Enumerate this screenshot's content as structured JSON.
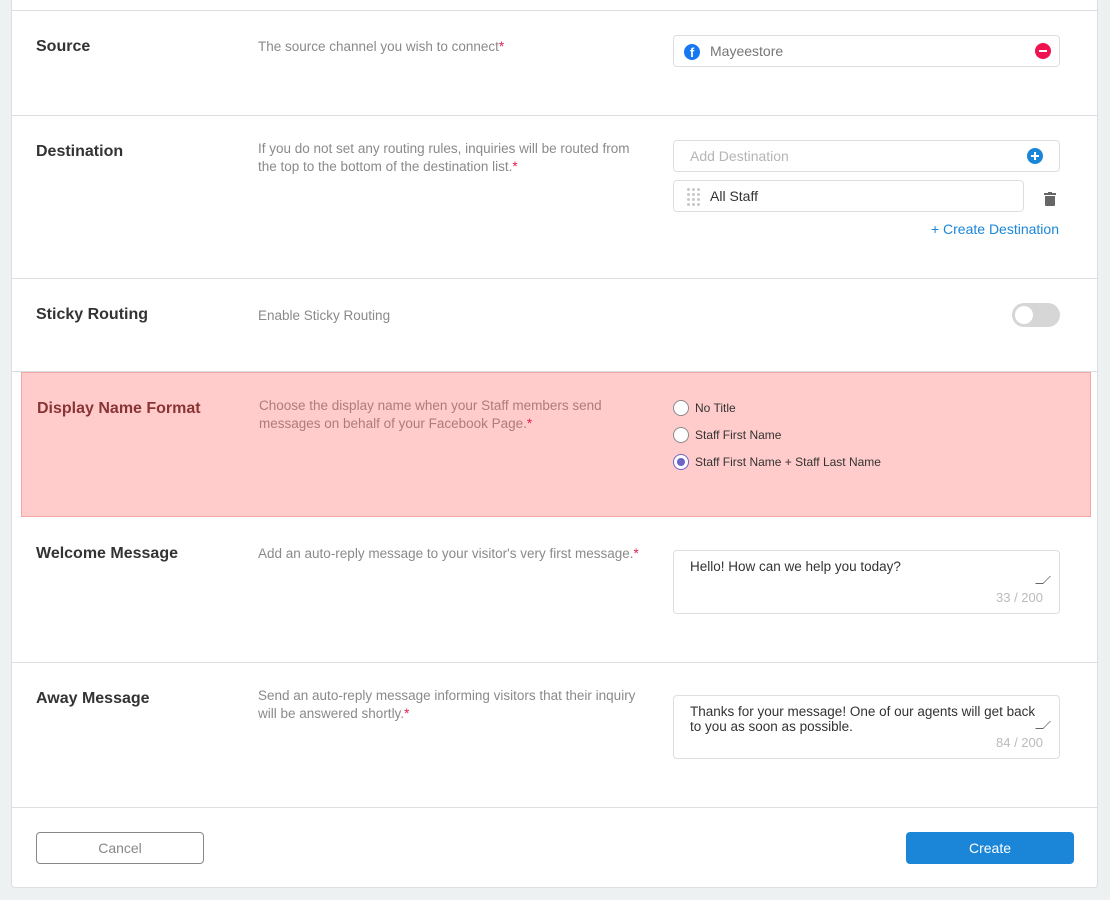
{
  "sections": {
    "source": {
      "title": "Source",
      "description": "The source channel you wish to connect",
      "required": "*",
      "value": "Mayeestore"
    },
    "destination": {
      "title": "Destination",
      "description": "If you do not set any routing rules, inquiries will be routed from the top to the bottom of the destination list.",
      "required": "*",
      "add_placeholder": "Add Destination",
      "items": [
        "All Staff"
      ],
      "create_link": "+ Create Destination"
    },
    "sticky_routing": {
      "title": "Sticky Routing",
      "description": "Enable Sticky Routing",
      "enabled": false
    },
    "display_name_format": {
      "title": "Display Name Format",
      "description": "Choose the display name when your Staff members send messages on behalf of your Facebook Page.",
      "required": "*",
      "options": [
        "No Title",
        "Staff First Name",
        "Staff First Name + Staff Last Name"
      ],
      "selected": "Staff First Name + Staff Last Name"
    },
    "welcome_message": {
      "title": "Welcome Message",
      "description": "Add an auto-reply message to your visitor's very first message.",
      "required": "*",
      "value": "Hello! How can we help you today?",
      "count": "33 / 200"
    },
    "away_message": {
      "title": "Away Message",
      "description": "Send an auto-reply message informing visitors that their inquiry will be answered shortly.",
      "required": "*",
      "value": "Thanks for your message! One of our agents will get back to you as soon as possible.",
      "count": "84 / 200"
    }
  },
  "footer": {
    "cancel_label": "Cancel",
    "create_label": "Create"
  },
  "colors": {
    "accent": "#1b86d8",
    "required": "#e02050",
    "highlight": "#ffcbcb",
    "radio_selected": "#6b63c9"
  },
  "icons": {
    "source_channel": "facebook-icon",
    "remove": "minus-circle-icon",
    "add": "plus-circle-icon",
    "drag": "drag-handle-icon",
    "delete": "trash-icon"
  }
}
